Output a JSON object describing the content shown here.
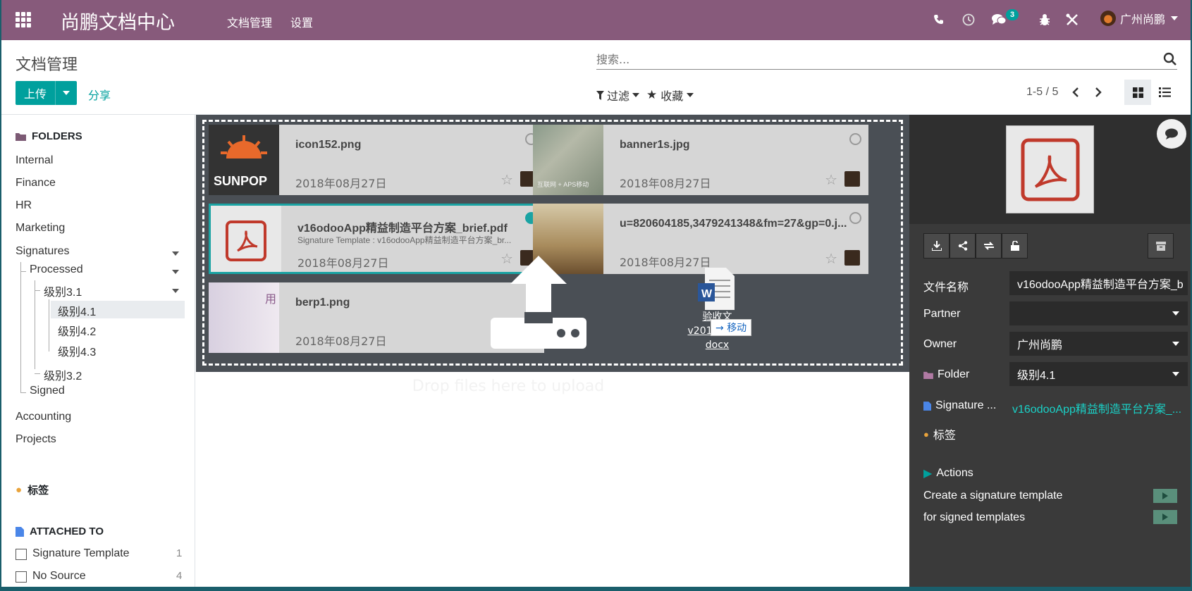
{
  "navbar": {
    "brand": "尚鹏文档中心",
    "menu": [
      "文档管理",
      "设置"
    ],
    "message_count": "3",
    "company": "广州尚鹏"
  },
  "control_panel": {
    "breadcrumb": "文档管理",
    "upload_label": "上传",
    "share_label": "分享",
    "search_placeholder": "搜索...",
    "filter_label": "过滤",
    "favorites_label": "收藏",
    "pager": "1-5 / 5"
  },
  "sidebar": {
    "folders_header": "FOLDERS",
    "folders": [
      "Internal",
      "Finance",
      "HR",
      "Marketing",
      "Signatures",
      "Processed",
      "级别3.1",
      "级别4.1",
      "级别4.2",
      "级别4.3",
      "级别3.2",
      "Signed",
      "Accounting",
      "Projects"
    ],
    "tags_header": "标签",
    "attached_header": "ATTACHED TO",
    "attached": [
      {
        "label": "Signature Template",
        "count": "1"
      },
      {
        "label": "No Source",
        "count": "4"
      }
    ]
  },
  "cards": [
    {
      "name": "icon152.png",
      "date": "2018年08月27日",
      "thumb_text": "SUNPOP"
    },
    {
      "name": "banner1s.jpg",
      "date": "2018年08月27日",
      "thumb_text": "互联网 + APS移动"
    },
    {
      "name": "v16odooApp精益制造平台方案_brief.pdf",
      "sub": "Signature Template : v16odooApp精益制造平台方案_br...",
      "date": "2018年08月27日"
    },
    {
      "name": "u=820604185,3479241348&fm=27&gp=0.j...",
      "date": "2018年08月27日"
    },
    {
      "name": "berp1.png",
      "date": "2018年08月27日",
      "thumb_text": "用"
    }
  ],
  "drop_hint": "Drop files here to upload",
  "drag": {
    "file_lines": [
      "验收文",
      "v20180813.",
      "docx"
    ],
    "tip": "移动"
  },
  "panel": {
    "filename_label": "文件名称",
    "filename_value": "v16odooApp精益制造平台方案_b",
    "partner_label": "Partner",
    "partner_value": "",
    "owner_label": "Owner",
    "owner_value": "广州尚鹏",
    "folder_label": "Folder",
    "folder_value": "级别4.1",
    "signature_label": "Signature ...",
    "signature_value": "v16odooApp精益制造平台方案_...",
    "tags_label": "标签",
    "actions_label": "Actions",
    "actions": [
      "Create a signature template",
      "for signed templates"
    ]
  },
  "colors": {
    "brand": "#875a7b",
    "accent": "#00a09d",
    "panel": "#3a3a3a"
  }
}
